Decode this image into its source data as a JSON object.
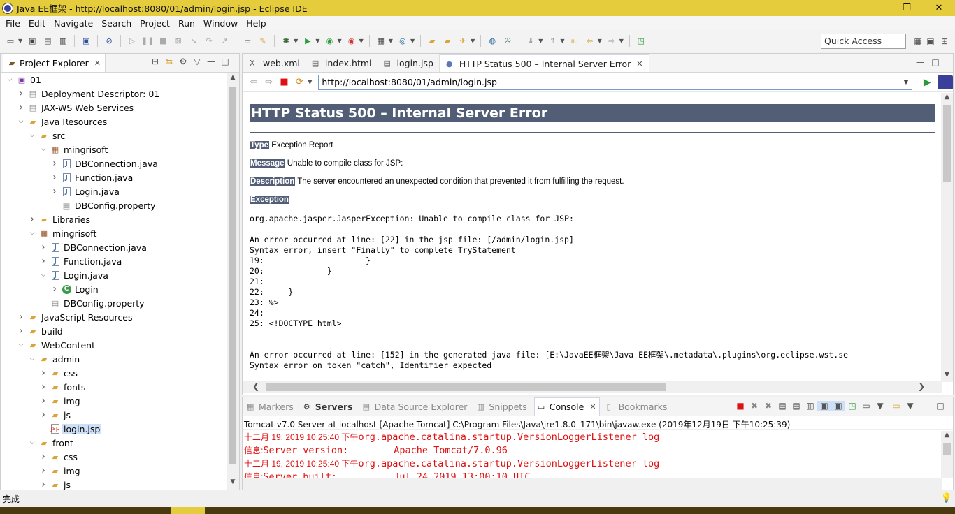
{
  "window": {
    "title": "Java EE框架 - http://localhost:8080/01/admin/login.jsp - Eclipse IDE",
    "minimize": "—",
    "maximize": "❐",
    "close": "✕"
  },
  "menu": [
    "File",
    "Edit",
    "Navigate",
    "Search",
    "Project",
    "Run",
    "Window",
    "Help"
  ],
  "toolbar": {
    "quick_access_placeholder": "Quick Access"
  },
  "project_explorer": {
    "tab_label": "Project Explorer",
    "tree": [
      {
        "label": "01",
        "depth": 0,
        "twisty": "open",
        "icon": "proj"
      },
      {
        "label": "Deployment Descriptor: 01",
        "depth": 1,
        "twisty": "closed",
        "icon": "file"
      },
      {
        "label": "JAX-WS Web Services",
        "depth": 1,
        "twisty": "closed",
        "icon": "file"
      },
      {
        "label": "Java Resources",
        "depth": 1,
        "twisty": "open",
        "icon": "folder"
      },
      {
        "label": "src",
        "depth": 2,
        "twisty": "open",
        "icon": "folder"
      },
      {
        "label": "mingrisoft",
        "depth": 3,
        "twisty": "open",
        "icon": "pkg"
      },
      {
        "label": "DBConnection.java",
        "depth": 4,
        "twisty": "closed",
        "icon": "java"
      },
      {
        "label": "Function.java",
        "depth": 4,
        "twisty": "closed",
        "icon": "java"
      },
      {
        "label": "Login.java",
        "depth": 4,
        "twisty": "closed",
        "icon": "java"
      },
      {
        "label": "DBConfig.property",
        "depth": 4,
        "twisty": "none",
        "icon": "file"
      },
      {
        "label": "Libraries",
        "depth": 2,
        "twisty": "closed",
        "icon": "folder"
      },
      {
        "label": "mingrisoft",
        "depth": 2,
        "twisty": "open",
        "icon": "pkg"
      },
      {
        "label": "DBConnection.java",
        "depth": 3,
        "twisty": "closed",
        "icon": "java"
      },
      {
        "label": "Function.java",
        "depth": 3,
        "twisty": "closed",
        "icon": "java"
      },
      {
        "label": "Login.java",
        "depth": 3,
        "twisty": "open",
        "icon": "java"
      },
      {
        "label": "Login",
        "depth": 4,
        "twisty": "closed",
        "icon": "class"
      },
      {
        "label": "DBConfig.property",
        "depth": 3,
        "twisty": "none",
        "icon": "file"
      },
      {
        "label": "JavaScript Resources",
        "depth": 1,
        "twisty": "closed",
        "icon": "folder"
      },
      {
        "label": "build",
        "depth": 1,
        "twisty": "closed",
        "icon": "folder"
      },
      {
        "label": "WebContent",
        "depth": 1,
        "twisty": "open",
        "icon": "folder"
      },
      {
        "label": "admin",
        "depth": 2,
        "twisty": "open",
        "icon": "folder"
      },
      {
        "label": "css",
        "depth": 3,
        "twisty": "closed",
        "icon": "folder"
      },
      {
        "label": "fonts",
        "depth": 3,
        "twisty": "closed",
        "icon": "folder"
      },
      {
        "label": "img",
        "depth": 3,
        "twisty": "closed",
        "icon": "folder"
      },
      {
        "label": "js",
        "depth": 3,
        "twisty": "closed",
        "icon": "folder"
      },
      {
        "label": "login.jsp",
        "depth": 3,
        "twisty": "none",
        "icon": "jsp",
        "selected": true
      },
      {
        "label": "front",
        "depth": 2,
        "twisty": "open",
        "icon": "folder"
      },
      {
        "label": "css",
        "depth": 3,
        "twisty": "closed",
        "icon": "folder"
      },
      {
        "label": "img",
        "depth": 3,
        "twisty": "closed",
        "icon": "folder"
      },
      {
        "label": "js",
        "depth": 3,
        "twisty": "closed",
        "icon": "folder"
      }
    ]
  },
  "editor": {
    "tabs": [
      {
        "label": "web.xml",
        "icon": "xml-icon",
        "glyph": "X"
      },
      {
        "label": "index.html",
        "icon": "file-icon",
        "glyph": "▤"
      },
      {
        "label": "login.jsp",
        "icon": "file-icon",
        "glyph": "▤"
      },
      {
        "label": "HTTP Status 500 – Internal Server Error",
        "icon": "globe-icon",
        "glyph": "●",
        "active": true
      }
    ],
    "url": "http://localhost:8080/01/admin/login.jsp"
  },
  "error_page": {
    "title": "HTTP Status 500 – Internal Server Error",
    "type_label": "Type",
    "type_value": " Exception Report",
    "message_label": "Message",
    "message_value": " Unable to compile class for JSP:",
    "description_label": "Description",
    "description_value": " The server encountered an unexpected condition that prevented it from fulfilling the request.",
    "exception_label": "Exception",
    "trace": "org.apache.jasper.JasperException: Unable to compile class for JSP:\n\nAn error occurred at line: [22] in the jsp file: [/admin/login.jsp]\nSyntax error, insert \"Finally\" to complete TryStatement\n19:                     }\n20:             }\n21: \n22:     }\n23: %>\n24: \n25: <!DOCTYPE html>\n\n\nAn error occurred at line: [152] in the generated java file: [E:\\JavaEE框架\\Java EE框架\\.metadata\\.plugins\\org.eclipse.wst.se\nSyntax error on token \"catch\", Identifier expected"
  },
  "console": {
    "tabs": [
      {
        "label": "Markers",
        "name": "markers",
        "glyph": "▦"
      },
      {
        "label": "Servers",
        "name": "servers",
        "glyph": "⚙",
        "bold": true
      },
      {
        "label": "Data Source Explorer",
        "name": "data-source-explorer",
        "glyph": "▤"
      },
      {
        "label": "Snippets",
        "name": "snippets",
        "glyph": "▥"
      },
      {
        "label": "Console",
        "name": "console",
        "glyph": "▭",
        "active": true
      },
      {
        "label": "Bookmarks",
        "name": "bookmarks",
        "glyph": "▯"
      }
    ],
    "description": "Tomcat v7.0 Server at localhost [Apache Tomcat] C:\\Program Files\\Java\\jre1.8.0_171\\bin\\javaw.exe (2019年12月19日 下午10:25:39)",
    "lines": [
      {
        "ts": "十二月 19, 2019 10:25:40 下午 ",
        "msg": "org.apache.catalina.startup.VersionLoggerListener log"
      },
      {
        "ts": "信息: ",
        "msg": "Server version:        Apache Tomcat/7.0.96"
      },
      {
        "ts": "十二月 19, 2019 10:25:40 下午 ",
        "msg": "org.apache.catalina.startup.VersionLoggerListener log"
      },
      {
        "ts": "信息: ",
        "msg": "Server built:          Jul 24 2019 13:00:10 UTC"
      }
    ]
  },
  "status": {
    "text": "完成"
  }
}
